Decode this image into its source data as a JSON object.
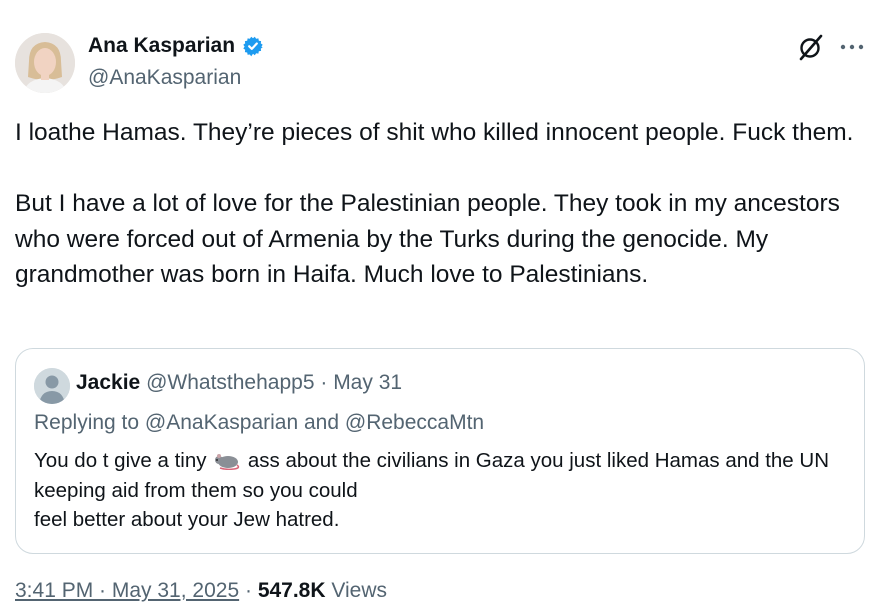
{
  "author": {
    "name": "Ana Kasparian",
    "handle": "@AnaKasparian",
    "verified_color": "#1d9bf0"
  },
  "tweet": {
    "paragraph1": "I loathe Hamas. They’re pieces of shit who killed innocent people. Fuck them.",
    "paragraph2": "But I have a lot of love for the Palestinian people. They took in my ancestors who were forced out of Armenia by the Turks during the genocide. My grandmother was born in Haifa. Much love to Palestinians."
  },
  "quote": {
    "name": "Jackie",
    "handle": "@Whatsthehapp5",
    "separator": "·",
    "date": "May 31",
    "replying_prefix": "Replying to",
    "replying_user1": "@AnaKasparian",
    "replying_and": "and",
    "replying_user2": "@RebeccaMtn",
    "text_before_emoji": "You do t give a tiny",
    "emoji_name": "rat-emoji",
    "text_after_emoji": "ass about the civilians in Gaza you just liked Hamas and the UN keeping aid from them so you could",
    "text_line3": "feel better about your Jew hatred."
  },
  "footer": {
    "time": "3:41 PM · May 31, 2025",
    "separator": "·",
    "views_count": "547.8K",
    "views_label": "Views"
  },
  "icons": {
    "grok": "grok-icon",
    "more": "more-options-icon"
  },
  "colors": {
    "text": "#0f1419",
    "secondary": "#536471",
    "border": "#cfd9de"
  }
}
